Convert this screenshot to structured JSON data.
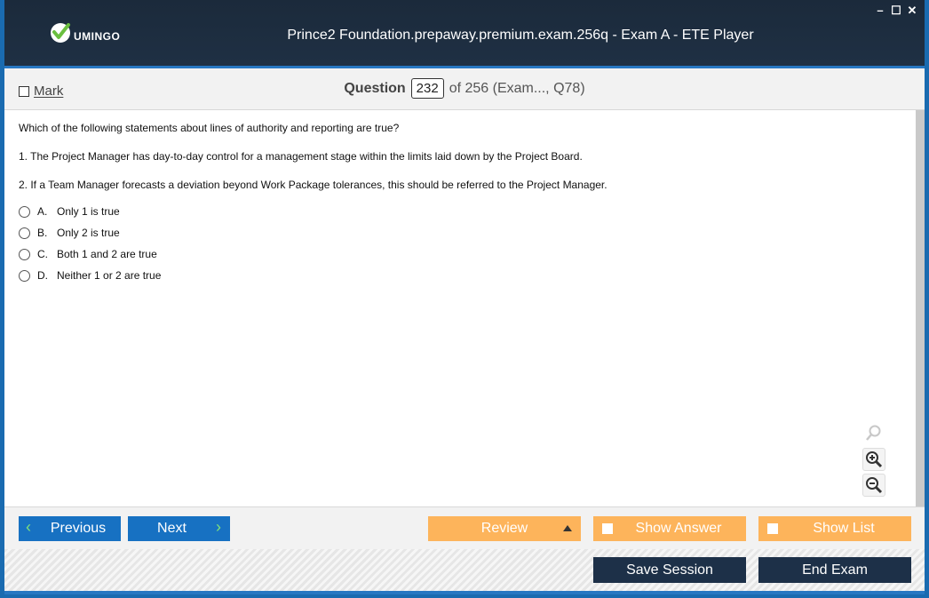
{
  "window": {
    "title": "Prince2 Foundation.prepaway.premium.exam.256q - Exam A - ETE Player",
    "controls": [
      "minimize-icon",
      "maximize-icon",
      "close-icon"
    ],
    "minimize_glyph": "–",
    "maximize_glyph": "☐",
    "close_glyph": "✕"
  },
  "logo": {
    "text": "UMINGO",
    "icon": "checkmark-circle-icon",
    "accent": "#6abf3f"
  },
  "header": {
    "mark_label": "Mark",
    "question_label": "Question",
    "question_number": "232",
    "of_text": "of 256 (Exam..., Q78)"
  },
  "question": {
    "stem": "Which of the following statements about lines of authority and reporting are true?",
    "statements": [
      "1. The Project Manager has day-to-day control for a management stage within the limits laid down by the Project Board.",
      "2. If a Team Manager forecasts a deviation beyond Work Package tolerances, this should be referred to the Project Manager."
    ],
    "options": [
      {
        "letter": "A.",
        "text": "Only 1 is true"
      },
      {
        "letter": "B.",
        "text": "Only 2 is true"
      },
      {
        "letter": "C.",
        "text": "Both 1 and 2 are true"
      },
      {
        "letter": "D.",
        "text": "Neither 1 or 2 are true"
      }
    ]
  },
  "zoom": {
    "icons": [
      "search-icon",
      "zoom-in-icon",
      "zoom-out-icon"
    ]
  },
  "nav": {
    "previous_label": "Previous",
    "next_label": "Next",
    "review_label": "Review",
    "show_answer_label": "Show Answer",
    "show_list_label": "Show List",
    "save_session_label": "Save Session",
    "end_exam_label": "End Exam"
  },
  "colors": {
    "title_bar": "#1b2a3b",
    "accent_blue": "#1771c2",
    "orange": "#fdb45b",
    "dark_button": "#1d3048",
    "chevron": "#7fe07a"
  }
}
